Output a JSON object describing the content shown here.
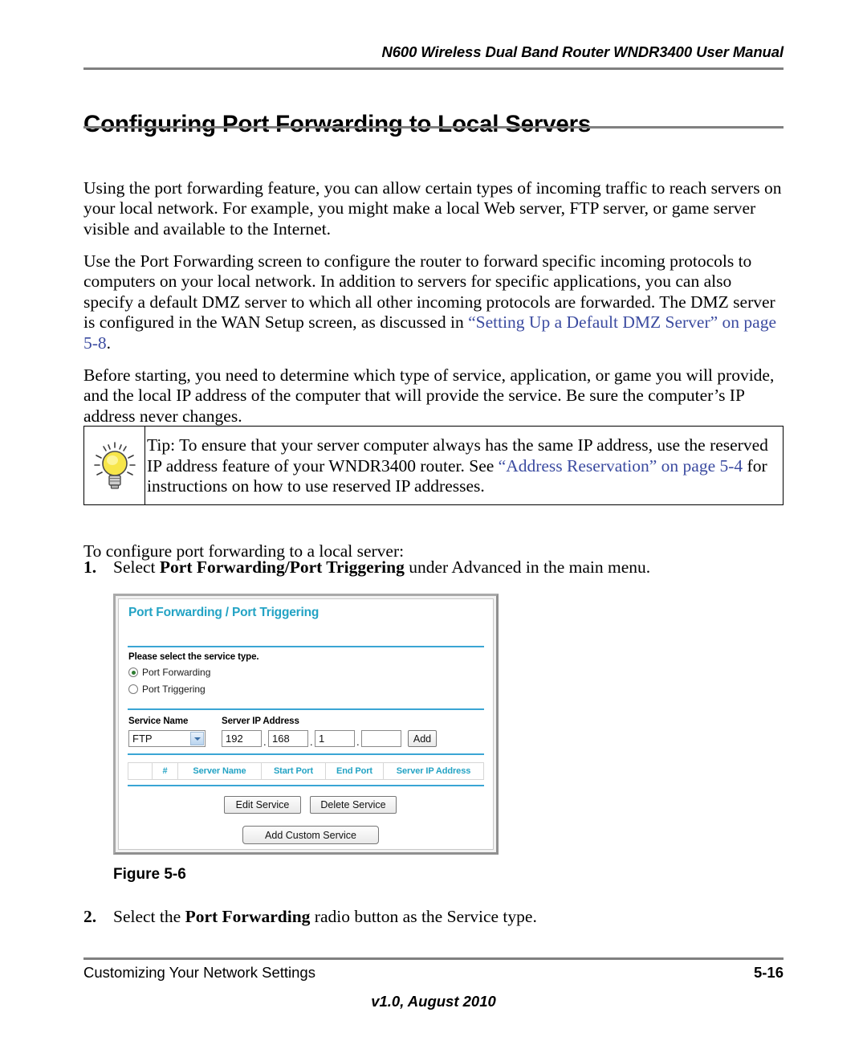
{
  "header": {
    "running_title": "N600 Wireless Dual Band Router WNDR3400 User Manual"
  },
  "title": "Configuring Port Forwarding to Local Servers",
  "body": {
    "para1": "Using the port forwarding feature, you can allow certain types of incoming traffic to reach servers on your local network. For example, you might make a local Web server, FTP server, or game server visible and available to the Internet.",
    "para2_before": "Use the Port Forwarding screen to configure the router to forward specific incoming protocols to computers on your local network. In addition to servers for specific applications, you can also specify a default DMZ server to which all other incoming protocols are forwarded. The DMZ server is configured in the WAN Setup screen, as discussed in ",
    "para2_link": "“Setting Up a Default DMZ Server” on page 5-8",
    "para2_after": ".",
    "para3": "Before starting, you need to determine which type of service, application, or game you will provide, and the local IP address of the computer that will provide the service. Be sure the computer’s IP address never changes.",
    "lead_in": "To configure port forwarding to a local server:"
  },
  "tip": {
    "label": "Tip:",
    "text_before": " To ensure that your server computer always has the same IP address, use the reserved IP address feature of your WNDR3400 router. See ",
    "link1": "“Address Reservation”",
    "link2": "on page 5-4",
    "text_after": " for instructions on how to use reserved IP addresses.",
    "icon": "lightbulb-icon"
  },
  "steps": [
    {
      "number": "1.",
      "text_before": "Select ",
      "bold": "Port Forwarding/Port Triggering",
      "text_after": " under Advanced in the main menu."
    },
    {
      "number": "2.",
      "text_before": "Select the ",
      "bold": "Port Forwarding",
      "text_after": " radio button as the Service type."
    }
  ],
  "figure": {
    "caption": "Figure 5-6",
    "ui": {
      "title": "Port Forwarding / Port Triggering",
      "service_type_label": "Please select the service type.",
      "radios": [
        {
          "label": "Port Forwarding",
          "selected": true
        },
        {
          "label": "Port Triggering",
          "selected": false
        }
      ],
      "service_name_label": "Service Name",
      "server_ip_label": "Server IP Address",
      "service_name_value": "FTP",
      "ip_octets": [
        "192",
        "168",
        "1",
        ""
      ],
      "ip_separator": ".",
      "add_button": "Add",
      "table_headers": [
        "",
        "#",
        "Server Name",
        "Start Port",
        "End Port",
        "Server IP Address"
      ],
      "buttons": {
        "edit_service": "Edit Service",
        "delete_service": "Delete Service",
        "add_custom_service": "Add Custom Service"
      },
      "colors": {
        "heading_cyan": "#23a3c4",
        "divider_blue": "#3aa5d4",
        "radio_selected_green": "#2f7d32"
      }
    }
  },
  "footer": {
    "left": "Customizing Your Network Settings",
    "right": "5-16",
    "center": "v1.0, August 2010"
  },
  "colors": {
    "link": "#3b4ba0",
    "rule_gray": "#808080"
  }
}
